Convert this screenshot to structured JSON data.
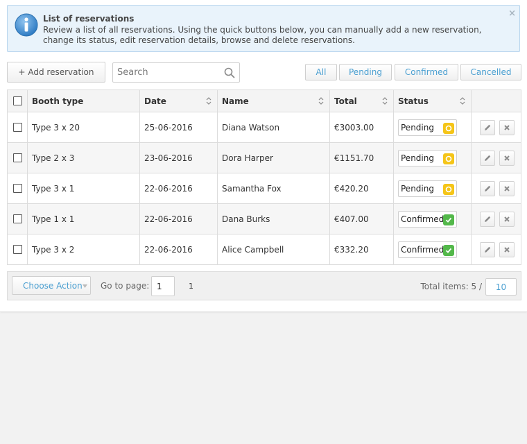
{
  "colors": {
    "accent": "#4a9fd1",
    "info_bg": "#e9f3fb",
    "pending": "#f5c518",
    "confirmed": "#53b84a"
  },
  "info": {
    "title": "List of reservations",
    "text": "Review a list of all reservations. Using the quick buttons below, you can manually add a new reservation, change its status, edit reservation details, browse and delete reservations.",
    "close_symbol": "×",
    "icon": "info-icon"
  },
  "toolbar": {
    "add_label": "+ Add reservation",
    "search_placeholder": "Search",
    "search_value": "",
    "filters": {
      "all": "All",
      "pending": "Pending",
      "confirmed": "Confirmed",
      "cancelled": "Cancelled"
    }
  },
  "table": {
    "headers": {
      "booth": "Booth type",
      "date": "Date",
      "name": "Name",
      "total": "Total",
      "status": "Status"
    },
    "rows": [
      {
        "booth": "Type 3 x 20",
        "date": "25-06-2016",
        "name": "Diana Watson",
        "total": "€3003.00",
        "status": "Pending"
      },
      {
        "booth": "Type 2 x 3",
        "date": "23-06-2016",
        "name": "Dora Harper",
        "total": "€1151.70",
        "status": "Pending"
      },
      {
        "booth": "Type 3 x 1",
        "date": "22-06-2016",
        "name": "Samantha Fox",
        "total": "€420.20",
        "status": "Pending"
      },
      {
        "booth": "Type 1 x 1",
        "date": "22-06-2016",
        "name": "Dana Burks",
        "total": "€407.00",
        "status": "Confirmed"
      },
      {
        "booth": "Type 3 x 2",
        "date": "22-06-2016",
        "name": "Alice Campbell",
        "total": "€332.20",
        "status": "Confirmed"
      }
    ]
  },
  "footer": {
    "choose_action": "Choose Action",
    "goto_label": "Go to page:",
    "goto_value": "1",
    "total_pages": "1",
    "total_items_label": "Total items: 5 /",
    "per_page": "10"
  }
}
